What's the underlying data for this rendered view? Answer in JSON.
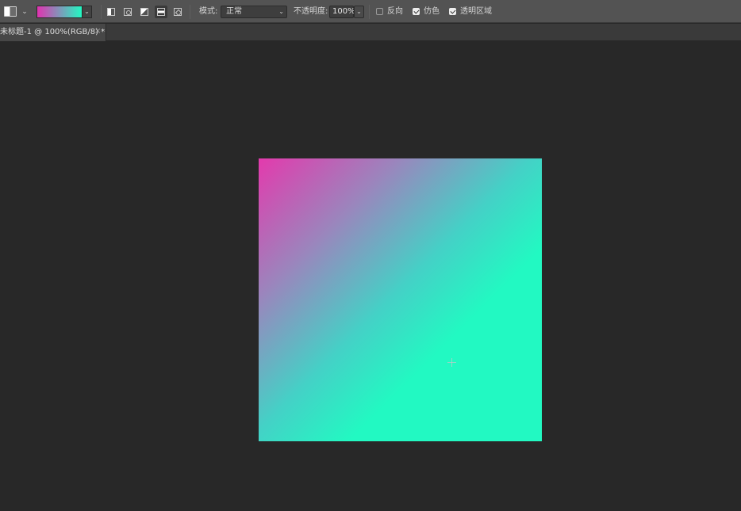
{
  "options_bar": {
    "tool_preset_icon": "gradient-tool-preset-icon",
    "gradient": {
      "stops": [
        "#e033b0",
        "#22f9c2"
      ]
    },
    "gradient_types": [
      {
        "name": "linear-gradient-icon",
        "active": false
      },
      {
        "name": "radial-gradient-icon",
        "active": false
      },
      {
        "name": "angle-gradient-icon",
        "active": false
      },
      {
        "name": "reflected-gradient-icon",
        "active": true
      },
      {
        "name": "diamond-gradient-icon",
        "active": false
      }
    ],
    "mode_label": "模式:",
    "mode_value": "正常",
    "opacity_label": "不透明度:",
    "opacity_value": "100%",
    "reverse_label": "反向",
    "reverse_checked": false,
    "dither_label": "仿色",
    "dither_checked": true,
    "transparency_label": "透明区域",
    "transparency_checked": true
  },
  "document_tab": {
    "title": "未标题-1 @ 100%(RGB/8) *",
    "close": "×"
  },
  "canvas": {
    "gradient_colors": [
      "#e33aad",
      "#9a86bd",
      "#44d1c6",
      "#22f9c2"
    ],
    "background": "#282828"
  }
}
